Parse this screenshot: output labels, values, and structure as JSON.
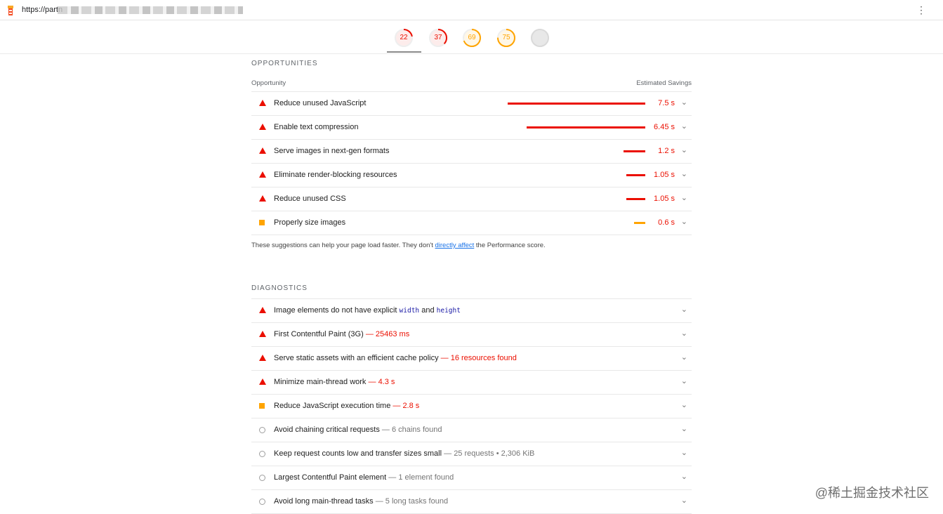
{
  "topbar": {
    "url": "https://partn",
    "menu_icon": "more-vert-icon"
  },
  "gauges": [
    {
      "score": "22",
      "color": "#eb0f00",
      "fraction": 0.22
    },
    {
      "score": "37",
      "color": "#eb0f00",
      "fraction": 0.37
    },
    {
      "score": "69",
      "color": "#ffa400",
      "fraction": 0.69
    },
    {
      "score": "75",
      "color": "#ffa400",
      "fraction": 0.75
    },
    {
      "score": "",
      "color": "#c9c9c9",
      "fraction": 0
    }
  ],
  "opportunities": {
    "title": "OPPORTUNITIES",
    "col_left": "Opportunity",
    "col_right": "Estimated Savings",
    "items": [
      {
        "label": "Reduce unused JavaScript",
        "savings": "7.5 s",
        "severity": "fail",
        "bar_fraction": 1.0
      },
      {
        "label": "Enable text compression",
        "savings": "6.45 s",
        "severity": "fail",
        "bar_fraction": 0.86
      },
      {
        "label": "Serve images in next-gen formats",
        "savings": "1.2 s",
        "severity": "fail",
        "bar_fraction": 0.16
      },
      {
        "label": "Eliminate render-blocking resources",
        "savings": "1.05 s",
        "severity": "fail",
        "bar_fraction": 0.14
      },
      {
        "label": "Reduce unused CSS",
        "savings": "1.05 s",
        "severity": "fail",
        "bar_fraction": 0.14
      },
      {
        "label": "Properly size images",
        "savings": "0.6 s",
        "severity": "average",
        "bar_fraction": 0.08
      }
    ],
    "note_before": "These suggestions can help your page load faster. They don't ",
    "note_link": "directly affect",
    "note_after": " the Performance score."
  },
  "diagnostics": {
    "title": "DIAGNOSTICS",
    "items": [
      {
        "severity": "fail",
        "label": "Image elements do not have explicit ",
        "code1": "width",
        "mid": " and ",
        "code2": "height",
        "extra": ""
      },
      {
        "severity": "fail",
        "label": "First Contentful Paint (3G)",
        "extra": "25463 ms"
      },
      {
        "severity": "fail",
        "label": "Serve static assets with an efficient cache policy",
        "extra": "16 resources found"
      },
      {
        "severity": "fail",
        "label": "Minimize main-thread work",
        "extra": "4.3 s"
      },
      {
        "severity": "average",
        "label": "Reduce JavaScript execution time",
        "extra": "2.8 s"
      },
      {
        "severity": "info",
        "label": "Avoid chaining critical requests",
        "extra": "6 chains found"
      },
      {
        "severity": "info",
        "label": "Keep request counts low and transfer sizes small",
        "extra": "25 requests • 2,306 KiB"
      },
      {
        "severity": "info",
        "label": "Largest Contentful Paint element",
        "extra": "1 element found"
      },
      {
        "severity": "info",
        "label": "Avoid long main-thread tasks",
        "extra": "5 long tasks found"
      }
    ]
  },
  "watermark": "@稀土掘金技术社区"
}
